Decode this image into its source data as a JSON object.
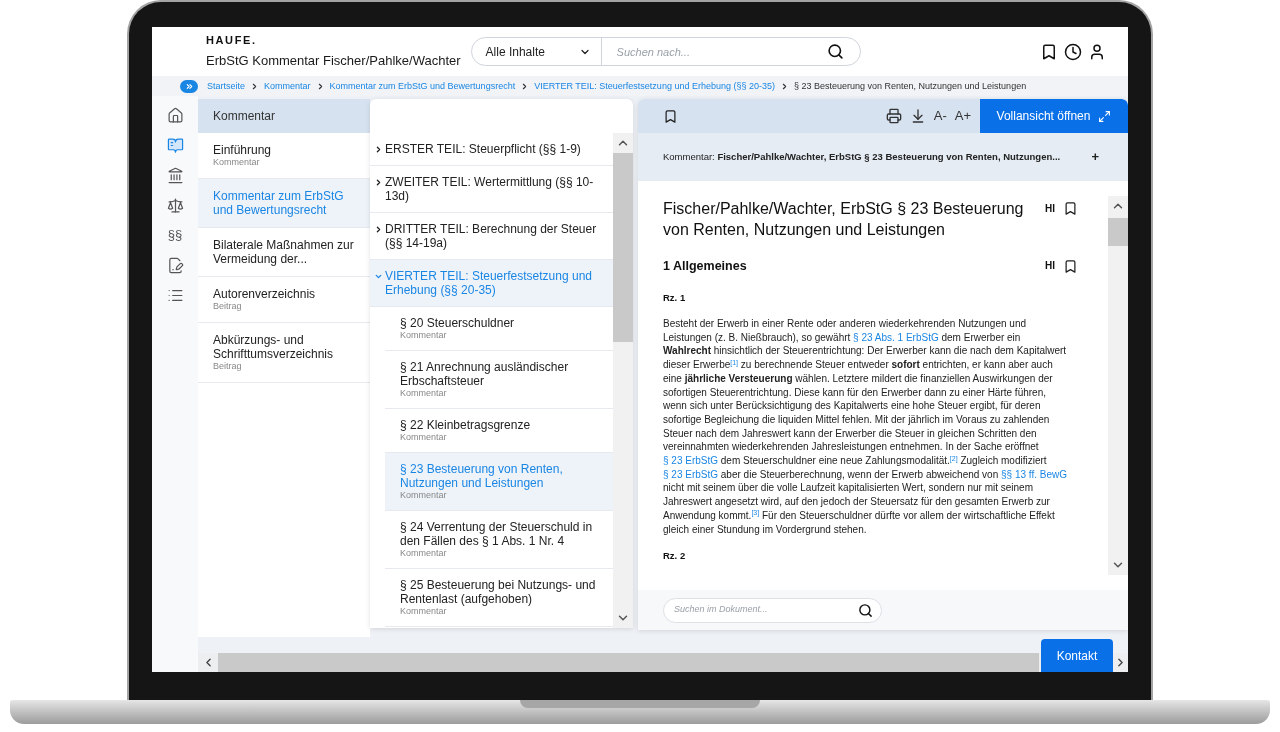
{
  "header": {
    "logo": "HAUFE.",
    "title": "ErbStG Kommentar Fischer/Pahlke/Wachter",
    "scope": "Alle Inhalte",
    "search": {
      "placeholder": "Suchen nach..."
    }
  },
  "breadcrumb": [
    {
      "label": "Startseite",
      "current": false
    },
    {
      "label": "Kommentar",
      "current": false
    },
    {
      "label": "Kommentar zum ErbStG und Bewertungsrecht",
      "current": false
    },
    {
      "label": "VIERTER TEIL: Steuerfestsetzung und Erhebung (§§ 20-35)",
      "current": false
    },
    {
      "label": "§ 23 Besteuerung von Renten, Nutzungen und Leistungen",
      "current": true
    }
  ],
  "rail": [
    {
      "selected": false
    },
    {
      "selected": true
    },
    {
      "selected": false
    },
    {
      "selected": false
    },
    {
      "label": "§§",
      "selected": false
    },
    {
      "selected": false
    },
    {
      "selected": false
    }
  ],
  "sidebar": {
    "title": "Kommentar",
    "items": [
      {
        "title": "Einführung",
        "subtitle": "Kommentar",
        "selected": false
      },
      {
        "title": "Kommentar zum ErbStG und Bewertungsrecht",
        "selected": true
      },
      {
        "title": "Bilaterale Maßnahmen zur Vermeidung der...",
        "selected": false
      },
      {
        "title": "Autorenverzeichnis",
        "subtitle": "Beitrag",
        "selected": false
      },
      {
        "title": "Abkürzungs- und Schrifttumsverzeichnis",
        "subtitle": "Beitrag",
        "selected": false
      }
    ]
  },
  "toc": {
    "items": [
      {
        "label": "ERSTER TEIL: Steuerpflicht (§§ 1-9)",
        "expanded": false
      },
      {
        "label": "ZWEITER TEIL: Wertermittlung (§§ 10-13d)",
        "expanded": false
      },
      {
        "label": "DRITTER TEIL: Berechnung der Steuer (§§ 14-19a)",
        "expanded": false
      },
      {
        "label": "VIERTER TEIL: Steuerfestsetzung und Erhebung (§§ 20-35)",
        "expanded": true,
        "children": [
          {
            "label": "§ 20 Steuerschuldner",
            "subtitle": "Kommentar",
            "selected": false
          },
          {
            "label": "§ 21 Anrechnung ausländischer Erbschaftsteuer",
            "subtitle": "Kommentar",
            "selected": false
          },
          {
            "label": "§ 22 Kleinbetragsgrenze",
            "subtitle": "Kommentar",
            "selected": false
          },
          {
            "label": "§ 23 Besteuerung von Renten, Nutzungen und Leistungen",
            "subtitle": "Kommentar",
            "selected": true
          },
          {
            "label": "§ 24 Verrentung der Steuerschuld in den Fällen des § 1 Abs. 1 Nr. 4",
            "subtitle": "Kommentar",
            "selected": false
          },
          {
            "label": "§ 25 Besteuerung bei Nutzungs- und Rentenlast (aufgehoben)",
            "subtitle": "Kommentar",
            "selected": false
          }
        ]
      }
    ]
  },
  "document": {
    "toolbar": {
      "decrease_font": "A-",
      "increase_font": "A+",
      "open_button": "Vollansicht öffnen"
    },
    "source": "Kommentar: **Fischer/Pahlke/Wachter, ErbStG § 23 Besteuerung von Renten, Nutzungen...**",
    "expand": "+",
    "title": "Fischer/Pahlke/Wachter, ErbStG § 23 Besteuerung von Renten, Nutzungen und Leistungen",
    "title_tag": "HI",
    "blocks": [
      {
        "kind": "heading",
        "text": "1 Allgemeines",
        "tag": "HI"
      },
      {
        "kind": "margin_number",
        "text": "Rz. 1"
      },
      {
        "kind": "paragraph",
        "segments": [
          {
            "kind": "text",
            "text": "Besteht der Erwerb in einer Rente oder anderen wiederkehrenden Nutzungen und Leistungen (z. B. Nießbrauch), so gewährt "
          },
          {
            "kind": "link",
            "text": "§ 23 Abs. 1 ErbStG"
          },
          {
            "kind": "text",
            "text": " dem Erwerber ein **Wahlrecht** hinsichtlich der Steuerentrichtung: Der Erwerber kann die nach dem Kapitalwert dieser Erwerbe"
          },
          {
            "kind": "footnote",
            "text": "[1]"
          },
          {
            "kind": "text",
            "text": " zu berechnende Steuer entweder **sofort** entrichten, er kann aber auch eine **jährliche Versteuerung** wählen. Letztere mildert die finanziellen Auswirkungen der sofortigen Steuerentrichtung. Diese kann für den Erwerber dann zu einer Härte führen, wenn sich unter Berücksichtigung des Kapitalwerts eine hohe Steuer ergibt, für deren sofortige Begleichung die liquiden Mittel fehlen. Mit der jährlich im Voraus zu zahlenden Steuer nach dem Jahreswert kann der Erwerber die Steuer in gleichen Schritten den vereinnahmten wiederkehrenden Jahresleistungen entnehmen. In der Sache eröffnet "
          },
          {
            "kind": "link",
            "text": "§ 23 ErbStG"
          },
          {
            "kind": "text",
            "text": " dem Steuerschuldner eine neue Zahlungsmodalität."
          },
          {
            "kind": "footnote",
            "text": "[2]"
          },
          {
            "kind": "text",
            "text": " Zugleich modifiziert "
          },
          {
            "kind": "link",
            "text": "§ 23 ErbStG"
          },
          {
            "kind": "text",
            "text": " aber die Steuerberechnung, wenn der Erwerb abweichend von "
          },
          {
            "kind": "link",
            "text": "§§ 13 ff. BewG"
          },
          {
            "kind": "text",
            "text": " nicht mit seinem über die volle Laufzeit kapitalisierten Wert, sondern nur mit seinem Jahreswert angesetzt wird, auf den jedoch der Steuersatz für den gesamten Erwerb zur Anwendung kommt."
          },
          {
            "kind": "footnote",
            "text": "[3]"
          },
          {
            "kind": "text",
            "text": " Für den Steuerschuldner dürfte vor allem der wirtschaftliche Effekt gleich einer Stundung im Vordergrund stehen."
          }
        ]
      },
      {
        "kind": "margin_number",
        "text": "Rz. 2"
      }
    ],
    "search": {
      "placeholder": "Suchen im Dokument..."
    }
  },
  "contact_button": "Kontakt"
}
